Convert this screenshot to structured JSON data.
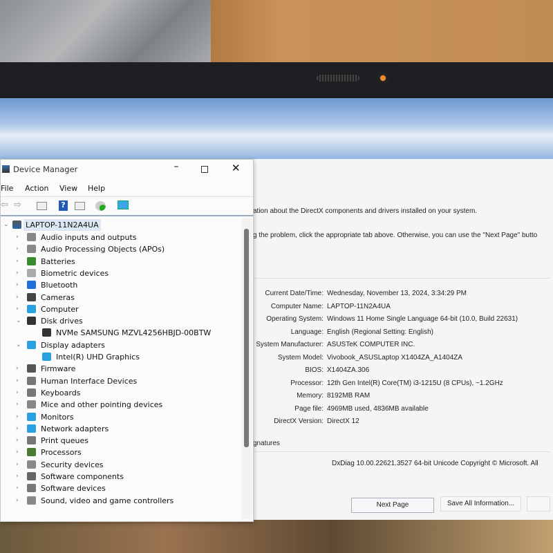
{
  "device_manager": {
    "title": "Device Manager",
    "menu": [
      "File",
      "Action",
      "View",
      "Help"
    ],
    "root": "LAPTOP-11N2A4UA",
    "tree": [
      {
        "label": "Audio inputs and outputs",
        "expanded": false,
        "icon": "speaker-icon",
        "color": "#888888"
      },
      {
        "label": "Audio Processing Objects (APOs)",
        "expanded": false,
        "icon": "speaker-icon",
        "color": "#888888"
      },
      {
        "label": "Batteries",
        "expanded": false,
        "icon": "battery-icon",
        "color": "#3a8a30"
      },
      {
        "label": "Biometric devices",
        "expanded": false,
        "icon": "fingerprint-icon",
        "color": "#aaaaaa"
      },
      {
        "label": "Bluetooth",
        "expanded": false,
        "icon": "bluetooth-icon",
        "color": "#1e6fd9"
      },
      {
        "label": "Cameras",
        "expanded": false,
        "icon": "camera-icon",
        "color": "#444444"
      },
      {
        "label": "Computer",
        "expanded": false,
        "icon": "computer-icon",
        "color": "#2aa0e0"
      },
      {
        "label": "Disk drives",
        "expanded": true,
        "icon": "disk-icon",
        "color": "#333333"
      },
      {
        "label": "NVMe SAMSUNG MZVL4256HBJD-00BTW",
        "child": true,
        "icon": "disk-icon",
        "color": "#333333"
      },
      {
        "label": "Display adapters",
        "expanded": true,
        "icon": "monitor-icon",
        "color": "#2aa0e0"
      },
      {
        "label": "Intel(R) UHD Graphics",
        "child": true,
        "icon": "monitor-icon",
        "color": "#2aa0e0"
      },
      {
        "label": "Firmware",
        "expanded": false,
        "icon": "chip-icon",
        "color": "#555555"
      },
      {
        "label": "Human Interface Devices",
        "expanded": false,
        "icon": "hid-icon",
        "color": "#777777"
      },
      {
        "label": "Keyboards",
        "expanded": false,
        "icon": "keyboard-icon",
        "color": "#777777"
      },
      {
        "label": "Mice and other pointing devices",
        "expanded": false,
        "icon": "mouse-icon",
        "color": "#888888"
      },
      {
        "label": "Monitors",
        "expanded": false,
        "icon": "monitor-icon",
        "color": "#2aa0e0"
      },
      {
        "label": "Network adapters",
        "expanded": false,
        "icon": "network-icon",
        "color": "#2aa0e0"
      },
      {
        "label": "Print queues",
        "expanded": false,
        "icon": "printer-icon",
        "color": "#777777"
      },
      {
        "label": "Processors",
        "expanded": false,
        "icon": "cpu-icon",
        "color": "#4a7a30"
      },
      {
        "label": "Security devices",
        "expanded": false,
        "icon": "security-icon",
        "color": "#888888"
      },
      {
        "label": "Software components",
        "expanded": false,
        "icon": "component-icon",
        "color": "#666666"
      },
      {
        "label": "Software devices",
        "expanded": false,
        "icon": "software-icon",
        "color": "#777777"
      },
      {
        "label": "Sound, video and game controllers",
        "expanded": false,
        "icon": "speaker-icon",
        "color": "#888888"
      }
    ]
  },
  "dxdiag": {
    "intro1": "ation about the DirectX components and drivers installed on your system.",
    "intro2": "g the problem, click the appropriate tab above.  Otherwise, you can use the \"Next Page\" butto",
    "fields": [
      {
        "label": "Current Date/Time:",
        "value": "Wednesday, November 13, 2024, 3:34:29 PM"
      },
      {
        "label": "Computer Name:",
        "value": "LAPTOP-11N2A4UA"
      },
      {
        "label": "Operating System:",
        "value": "Windows 11 Home Single Language 64-bit (10.0, Build 22631)"
      },
      {
        "label": "Language:",
        "value": "English (Regional Setting: English)"
      },
      {
        "label": "System Manufacturer:",
        "value": "ASUSTeK COMPUTER INC."
      },
      {
        "label": "System Model:",
        "value": "Vivobook_ASUSLaptop X1404ZA_A1404ZA"
      },
      {
        "label": "BIOS:",
        "value": "X1404ZA.306"
      },
      {
        "label": "Processor:",
        "value": "12th Gen Intel(R) Core(TM) i3-1215U (8 CPUs), ~1.2GHz"
      },
      {
        "label": "Memory:",
        "value": "8192MB RAM"
      },
      {
        "label": "Page file:",
        "value": "4969MB used, 4836MB available"
      },
      {
        "label": "DirectX Version:",
        "value": "DirectX 12"
      }
    ],
    "signatures": "gnatures",
    "footer": "DxDiag 10.00.22621.3527 64-bit Unicode  Copyright © Microsoft. All",
    "next_page": "Next Page",
    "save_all": "Save All Information..."
  }
}
